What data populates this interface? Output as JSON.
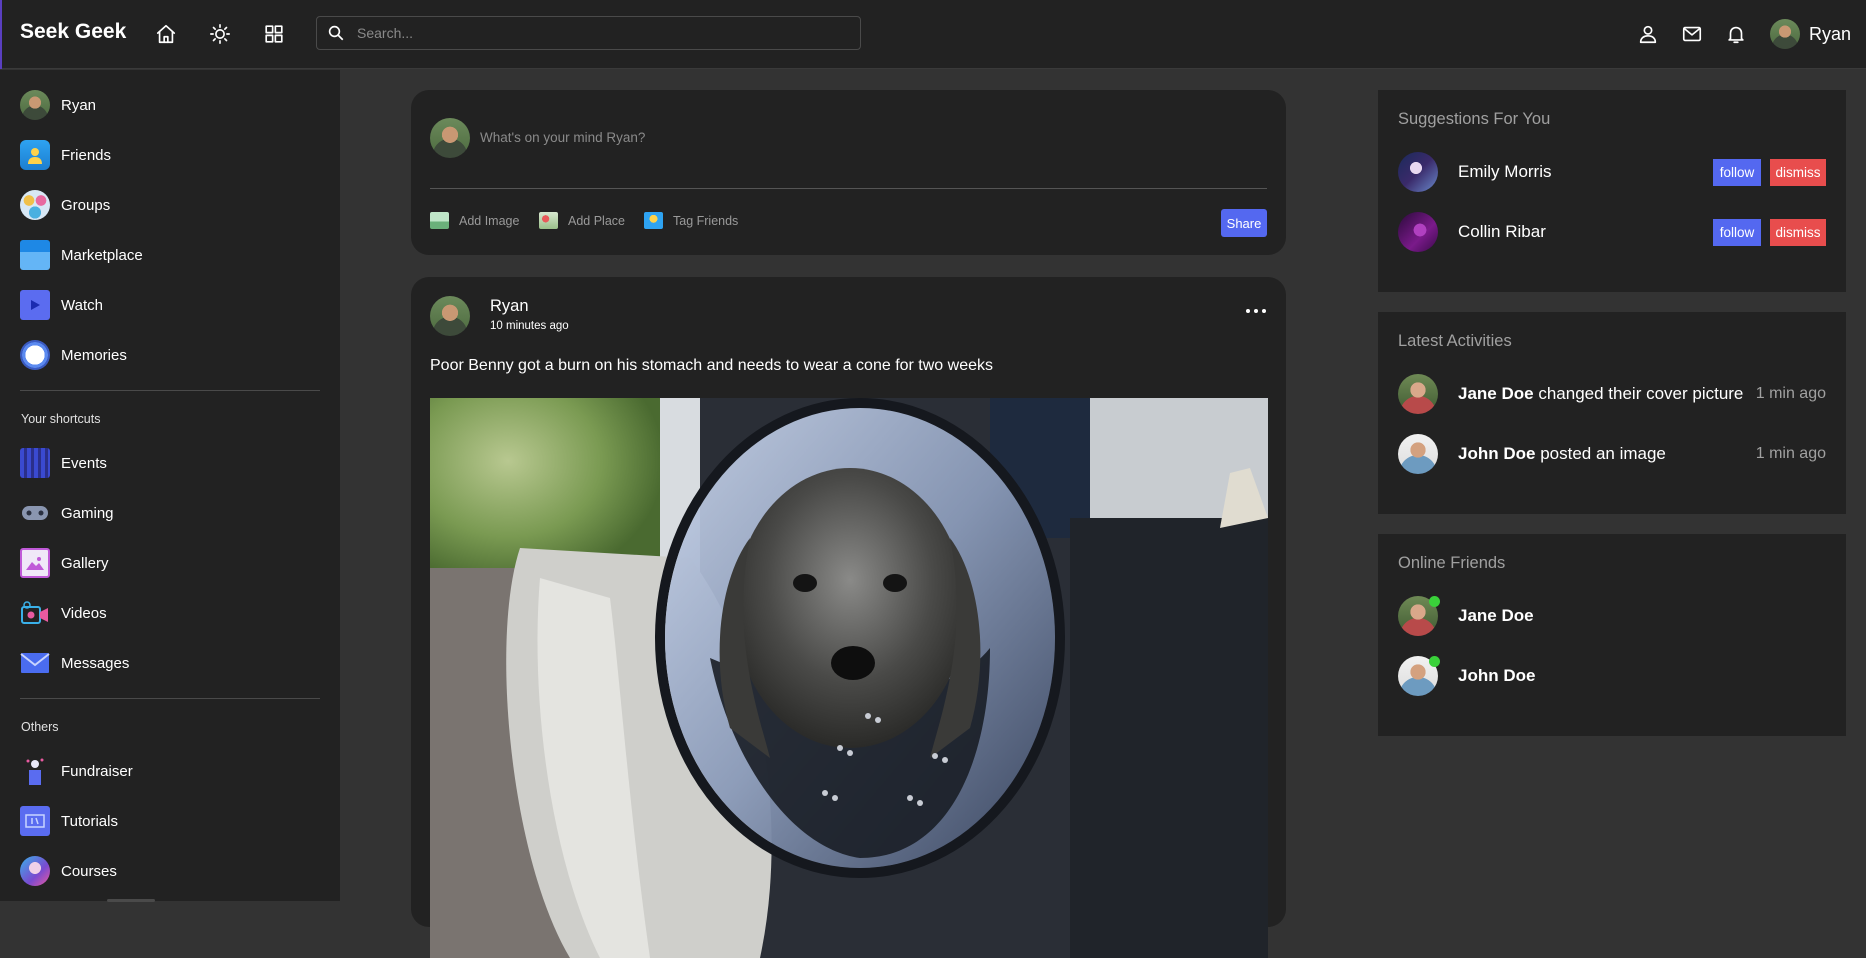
{
  "navbar": {
    "logo": "Seek Geek",
    "search_placeholder": "Search...",
    "user_name": "Ryan",
    "icons": [
      "home-icon",
      "sun-icon",
      "grid-icon",
      "person-icon",
      "mail-icon",
      "bell-icon"
    ]
  },
  "sidebar": {
    "main": [
      {
        "label": "Ryan",
        "icon": "avatar"
      },
      {
        "label": "Friends",
        "icon": "friends-icon"
      },
      {
        "label": "Groups",
        "icon": "groups-icon"
      },
      {
        "label": "Marketplace",
        "icon": "marketplace-icon"
      },
      {
        "label": "Watch",
        "icon": "watch-icon"
      },
      {
        "label": "Memories",
        "icon": "memories-icon"
      }
    ],
    "shortcuts_title": "Your shortcuts",
    "shortcuts": [
      {
        "label": "Events",
        "icon": "events-icon"
      },
      {
        "label": "Gaming",
        "icon": "gaming-icon"
      },
      {
        "label": "Gallery",
        "icon": "gallery-icon"
      },
      {
        "label": "Videos",
        "icon": "videos-icon"
      },
      {
        "label": "Messages",
        "icon": "messages-icon"
      }
    ],
    "others_title": "Others",
    "others": [
      {
        "label": "Fundraiser",
        "icon": "fundraiser-icon"
      },
      {
        "label": "Tutorials",
        "icon": "tutorials-icon"
      },
      {
        "label": "Courses",
        "icon": "courses-icon"
      }
    ]
  },
  "composer": {
    "placeholder": "What's on your mind Ryan?",
    "add_image": "Add Image",
    "add_place": "Add Place",
    "tag_friends": "Tag Friends",
    "share": "Share"
  },
  "post": {
    "author": "Ryan",
    "time": "10 minutes ago",
    "text": "Poor Benny got a burn on his stomach and needs to wear a cone for two weeks"
  },
  "suggestions": {
    "title": "Suggestions For You",
    "follow_label": "follow",
    "dismiss_label": "dismiss",
    "people": [
      {
        "name": "Emily Morris"
      },
      {
        "name": "Collin Ribar"
      }
    ]
  },
  "activities": {
    "title": "Latest Activities",
    "items": [
      {
        "name": "Jane Doe",
        "action": "changed their cover picture",
        "time": "1 min ago"
      },
      {
        "name": "John Doe",
        "action": "posted an image",
        "time": "1 min ago"
      }
    ]
  },
  "online": {
    "title": "Online Friends",
    "friends": [
      {
        "name": "Jane Doe"
      },
      {
        "name": "John Doe"
      }
    ]
  },
  "colors": {
    "background": "#333333",
    "panel": "#222222",
    "accent_blue": "#5468f0",
    "dismiss_red": "#e84d4d",
    "online_green": "#3ad13a"
  }
}
